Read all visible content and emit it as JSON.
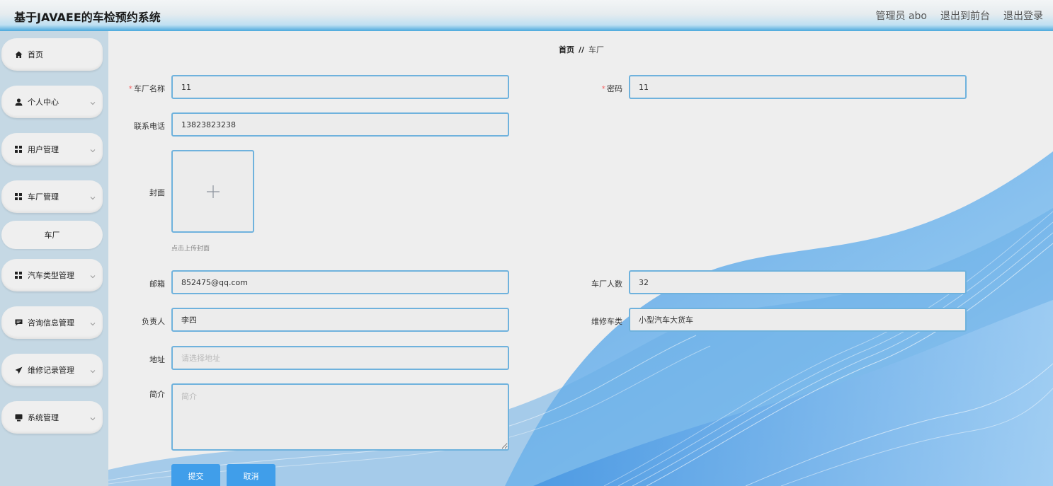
{
  "app": {
    "title": "基于JAVAEE的车检预约系统"
  },
  "header": {
    "user": "管理员 abo",
    "exit_front": "退出到前台",
    "logout": "退出登录"
  },
  "sidebar": {
    "items": [
      {
        "label": "首页",
        "icon": "home-icon"
      },
      {
        "label": "个人中心",
        "icon": "user-icon"
      },
      {
        "label": "用户管理",
        "icon": "grid-icon"
      },
      {
        "label": "车厂管理",
        "icon": "grid-icon"
      },
      {
        "label": "汽车类型管理",
        "icon": "grid-icon"
      },
      {
        "label": "咨询信息管理",
        "icon": "chat-icon"
      },
      {
        "label": "维修记录管理",
        "icon": "send-icon"
      },
      {
        "label": "系统管理",
        "icon": "monitor-icon"
      }
    ],
    "sub_item": "车厂"
  },
  "breadcrumb": {
    "home": "首页",
    "separator": "//",
    "current": "车厂"
  },
  "form": {
    "factory_name": {
      "label": "车厂名称",
      "value": "11"
    },
    "password": {
      "label": "密码",
      "value": "11"
    },
    "phone": {
      "label": "联系电话",
      "value": "13823823238"
    },
    "cover": {
      "label": "封面",
      "tip": "点击上传封面"
    },
    "email": {
      "label": "邮箱",
      "value": "852475@qq.com"
    },
    "staff_count": {
      "label": "车厂人数",
      "value": "32"
    },
    "manager": {
      "label": "负责人",
      "value": "李四"
    },
    "repair_types": {
      "label": "维修车类",
      "value": "小型汽车大货车"
    },
    "address": {
      "label": "地址",
      "value": "",
      "placeholder": "请选择地址"
    },
    "intro": {
      "label": "简介",
      "value": "",
      "placeholder": "简介"
    },
    "submit": "提交",
    "cancel": "取消"
  },
  "colors": {
    "accent": "#409eea",
    "border": "#6fb2dd",
    "required": "#f56c6c"
  }
}
